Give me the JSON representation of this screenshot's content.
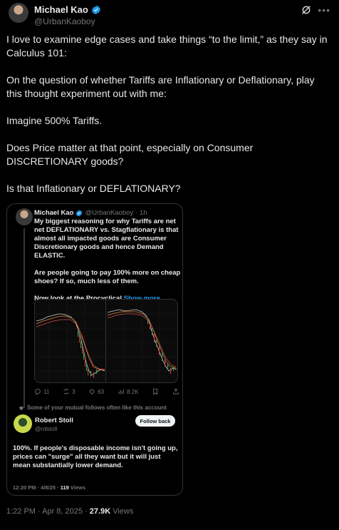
{
  "author": {
    "name": "Michael Kao",
    "handle": "@UrbanKaoboy"
  },
  "tweet": {
    "paragraphs": [
      "I love to examine edge cases and take things “to the limit,” as they say in Calculus 101:",
      "On the question of whether Tariffs are Inflationary or Deflationary, play this thought experiment out with me:",
      "Imagine 500% Tariffs.",
      "Does Price matter at that point, especially on Consumer DISCRETIONARY goods?",
      "Is that Inflationary or DEFLATIONARY?"
    ],
    "timestamp": "1:22 PM · Apr 8, 2025 · ",
    "views": "27.9K",
    "views_label": " Views"
  },
  "quote": {
    "name": "Michael Kao",
    "handle": "@UrbanKaoboy",
    "age": "· 1h",
    "paragraphs": [
      "My biggest reasoning for why Tariffs are net net DEFLATIONARY vs. Stagflationary is that almost all impacted goods are Consumer Discretionary goods and hence Demand ELASTIC.",
      "Are people going to pay 100% more on cheap shoes? If so, much less of them."
    ],
    "last_line": "Now look at the Procyclical ",
    "show_more": "Show more",
    "actions": {
      "replies": "11",
      "reposts": "3",
      "likes": "63",
      "views": "8.2K"
    },
    "mutual_note": "Some of your mutual follows often like this account",
    "reply": {
      "name": "Robert Stoll",
      "handle": "@rdstoll",
      "follow_label": "Follow back",
      "text": "100%. If people's disposable income isn't going up, prices can \"surge\" all they want but it will just mean substantially lower demand.",
      "time": "12:20 PM · 4/8/25 · ",
      "views": "119",
      "views_label": " Views"
    }
  },
  "colors": {
    "background": "#000000",
    "text": "#e7e9ea",
    "muted": "#71767b",
    "accent": "#1d9bf0",
    "border": "#2f3336"
  },
  "icons": [
    "verified-badge-icon",
    "grok-icon",
    "more-icon",
    "reply-icon",
    "repost-icon",
    "like-icon",
    "views-icon",
    "bookmark-icon",
    "share-icon",
    "heart-small-icon"
  ]
}
